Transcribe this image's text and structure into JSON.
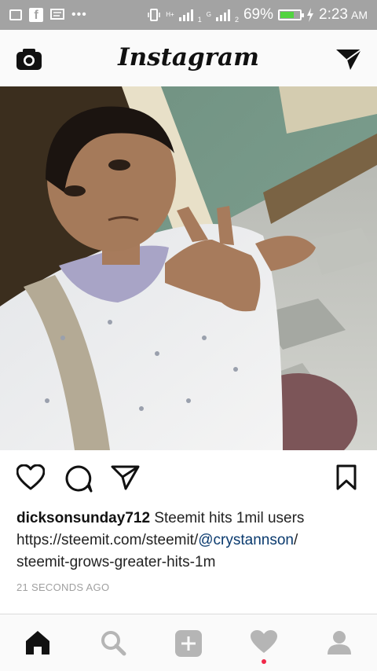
{
  "status_bar": {
    "battery_percent": "69%",
    "time": "2:23",
    "ampm": "AM",
    "network_1": "H+",
    "network_2": "G",
    "sim_1": "1",
    "sim_2": "2",
    "battery_level": 0.69,
    "battery_fill_color": "#52d43f"
  },
  "header": {
    "app_title": "Instagram"
  },
  "post": {
    "image_alt": "selfie photo",
    "username": "dicksonsunday712",
    "caption_text": "Steemit hits 1mil users",
    "link_prefix": "https://steemit.com/steemit/",
    "mention": "@crystannson",
    "link_suffix": "/",
    "link_tail": "steemit-grows-greater-hits-1m",
    "timestamp": "21 SECONDS AGO"
  },
  "icons": {
    "camera": "camera-icon",
    "direct": "direct-message-icon",
    "like": "heart-icon",
    "comment": "comment-icon",
    "share": "share-icon",
    "save": "bookmark-icon",
    "home": "home-icon",
    "search": "search-icon",
    "add": "add-icon",
    "activity": "activity-heart-icon",
    "profile": "profile-icon"
  },
  "colors": {
    "mention": "#0a3a6e",
    "notification_dot": "#f02849"
  }
}
